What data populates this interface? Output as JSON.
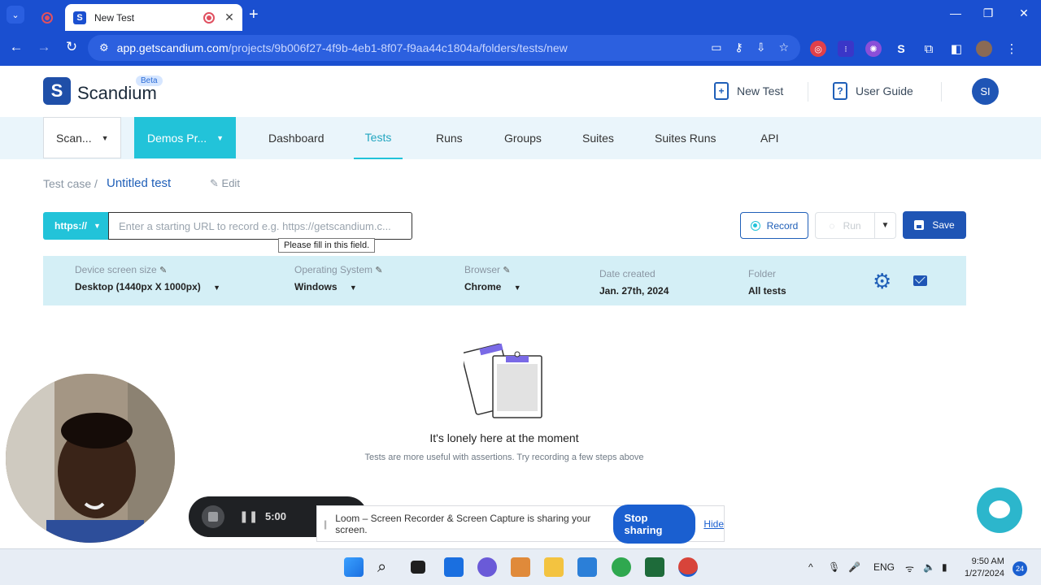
{
  "browser": {
    "tab_title": "New Test",
    "url_host": "app.getscandium.com",
    "url_path": "/projects/9b006f27-4f9b-4eb1-8f07-f9aa44c1804a/folders/tests/new"
  },
  "header": {
    "logo_text": "Scandium",
    "beta_badge": "Beta",
    "new_test": "New Test",
    "user_guide": "User Guide",
    "avatar_initials": "SI"
  },
  "nav": {
    "org_select": "Scan...",
    "project_select": "Demos Pr...",
    "items": [
      "Dashboard",
      "Tests",
      "Runs",
      "Groups",
      "Suites",
      "Suites Runs",
      "API"
    ],
    "active": "Tests"
  },
  "breadcrumb": {
    "parent": "Test case /",
    "title": "Untitled test",
    "edit": "Edit"
  },
  "url_row": {
    "protocol": "https://",
    "placeholder": "Enter a starting URL to record e.g. https://getscandium.c...",
    "tooltip": "Please fill in this field.",
    "record": "Record",
    "run": "Run",
    "save": "Save"
  },
  "settings": {
    "device_label": "Device screen size",
    "device_value": "Desktop (1440px X 1000px)",
    "os_label": "Operating System",
    "os_value": "Windows",
    "browser_label": "Browser",
    "browser_value": "Chrome",
    "date_label": "Date created",
    "date_value": "Jan. 27th, 2024",
    "folder_label": "Folder",
    "folder_value": "All tests"
  },
  "empty_state": {
    "title": "It's lonely here at the moment",
    "subtitle": "Tests are more useful with assertions. Try recording a few steps above"
  },
  "loom": {
    "timer": "5:00",
    "banner_text": "Loom – Screen Recorder & Screen Capture is sharing your screen.",
    "stop_sharing": "Stop sharing",
    "hide": "Hide"
  },
  "taskbar": {
    "lang": "ENG",
    "time": "9:50 AM",
    "date": "1/27/2024",
    "notifications": "24"
  },
  "colors": {
    "browser_blue": "#1a4fd0",
    "teal": "#22c3d9",
    "brand_blue": "#1f55b5",
    "settings_bg": "#d4eff6"
  }
}
